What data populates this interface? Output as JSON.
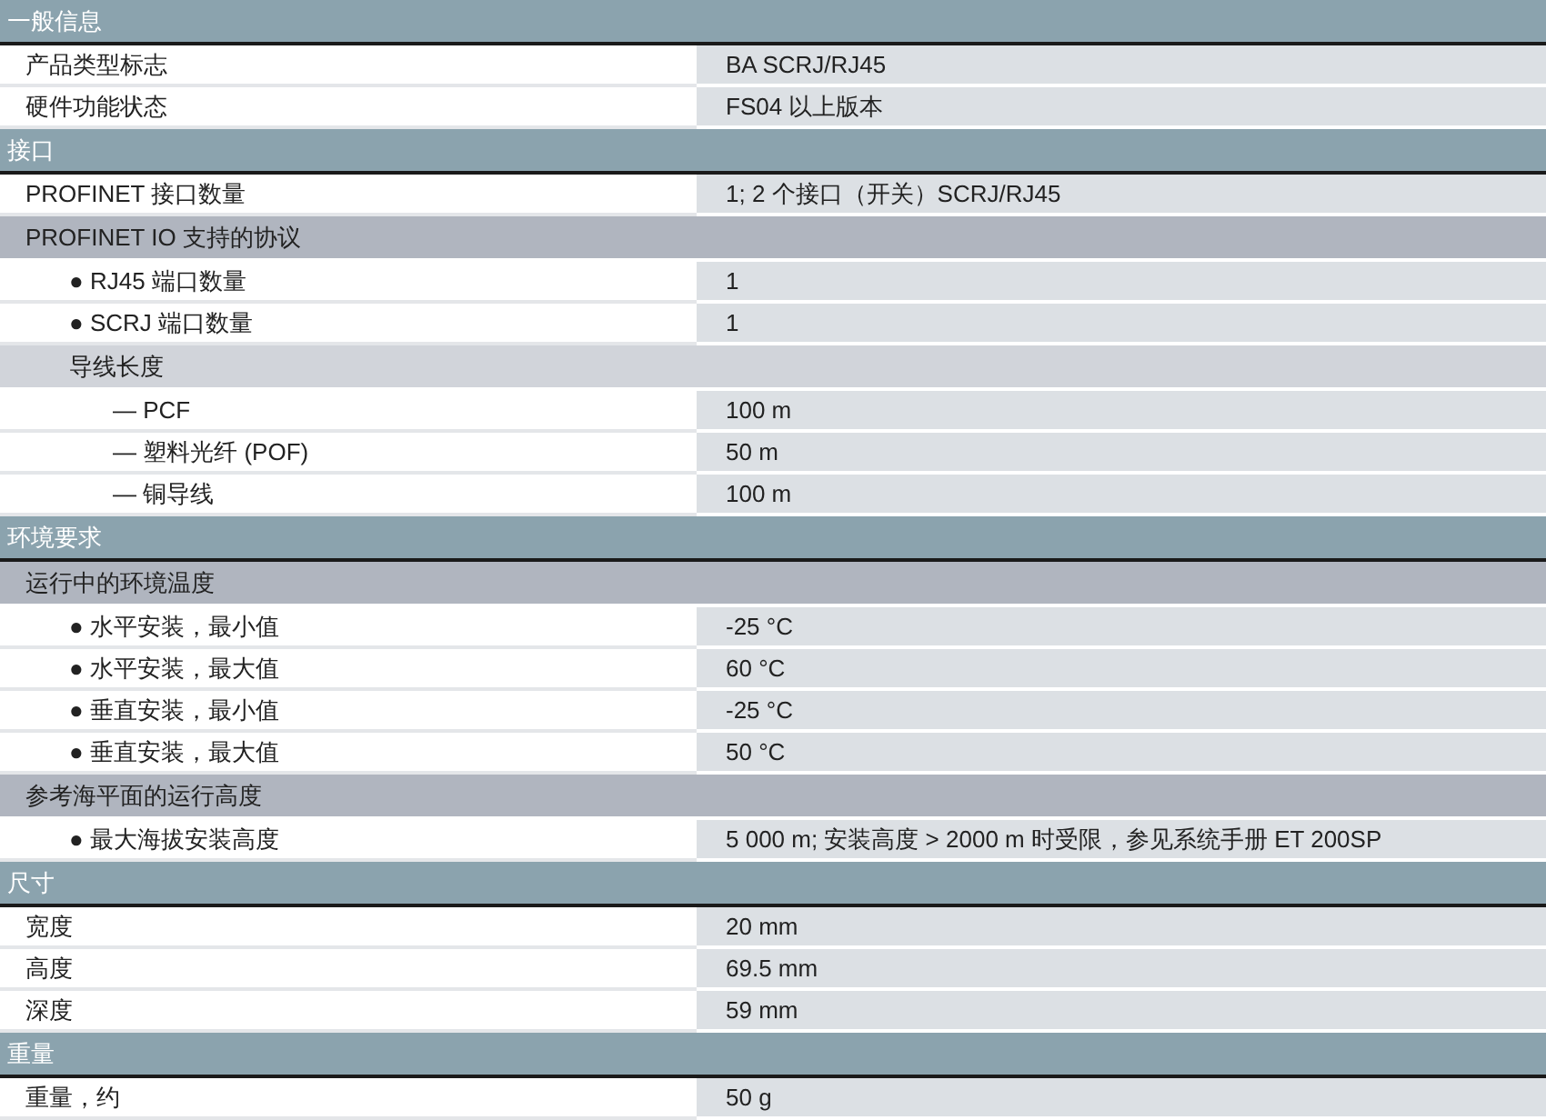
{
  "sections": [
    {
      "title": "一般信息",
      "rows": [
        {
          "kind": "item",
          "label": "产品类型标志",
          "value": "BA SCRJ/RJ45"
        },
        {
          "kind": "item",
          "label": "硬件功能状态",
          "value": "FS04 以上版本"
        }
      ]
    },
    {
      "title": "接口",
      "rows": [
        {
          "kind": "item",
          "label": "PROFINET 接口数量",
          "value": "1; 2 个接口（开关）SCRJ/RJ45"
        },
        {
          "kind": "group",
          "label": "PROFINET IO 支持的协议",
          "children": [
            {
              "kind": "item",
              "label": "● RJ45 端口数量",
              "value": "1"
            },
            {
              "kind": "item",
              "label": "● SCRJ 端口数量",
              "value": "1"
            },
            {
              "kind": "group",
              "label": "导线长度",
              "children": [
                {
                  "kind": "item",
                  "label": "— PCF",
                  "value": "100 m"
                },
                {
                  "kind": "item",
                  "label": "— 塑料光纤 (POF)",
                  "value": "50 m"
                },
                {
                  "kind": "item",
                  "label": "— 铜导线",
                  "value": "100 m"
                }
              ]
            }
          ]
        }
      ]
    },
    {
      "title": "环境要求",
      "rows": [
        {
          "kind": "group",
          "label": "运行中的环境温度",
          "children": [
            {
              "kind": "item",
              "label": "● 水平安装，最小值",
              "value": "-25 °C"
            },
            {
              "kind": "item",
              "label": "● 水平安装，最大值",
              "value": "60 °C"
            },
            {
              "kind": "item",
              "label": "● 垂直安装，最小值",
              "value": "-25 °C"
            },
            {
              "kind": "item",
              "label": "● 垂直安装，最大值",
              "value": "50 °C"
            }
          ]
        },
        {
          "kind": "group",
          "label": "参考海平面的运行高度",
          "children": [
            {
              "kind": "item",
              "label": "● 最大海拔安装高度",
              "value": "5 000 m; 安装高度 > 2000 m 时受限，参见系统手册 ET 200SP"
            }
          ]
        }
      ]
    },
    {
      "title": "尺寸",
      "rows": [
        {
          "kind": "item",
          "label": "宽度",
          "value": "20 mm"
        },
        {
          "kind": "item",
          "label": "高度",
          "value": "69.5 mm"
        },
        {
          "kind": "item",
          "label": "深度",
          "value": "59 mm"
        }
      ]
    },
    {
      "title": "重量",
      "rows": [
        {
          "kind": "item",
          "label": "重量，约",
          "value": "50 g"
        }
      ]
    }
  ]
}
